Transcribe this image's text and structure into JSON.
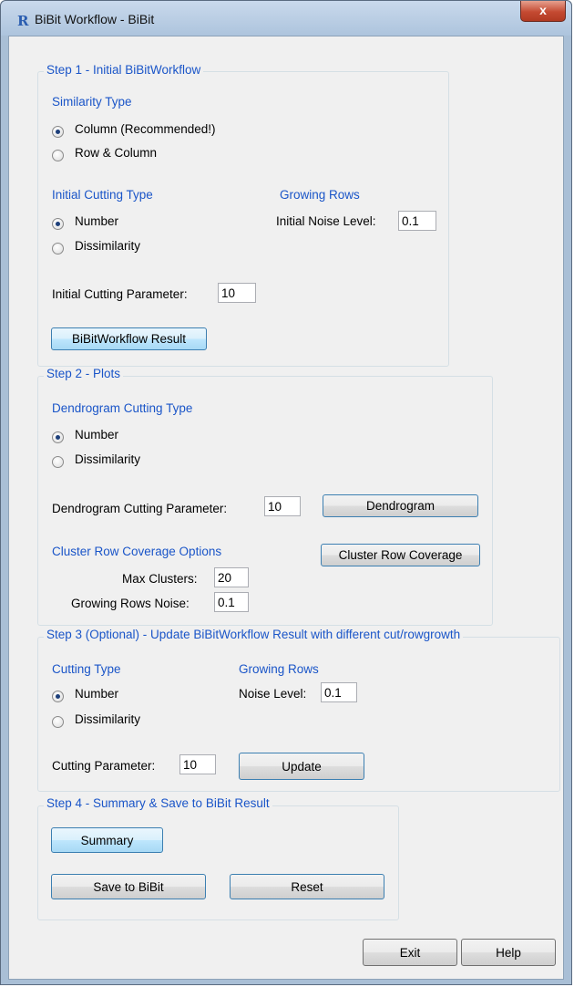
{
  "window": {
    "title": "BiBit Workflow - BiBit",
    "close_glyph": "x",
    "app_icon_glyph": "R"
  },
  "step1": {
    "legend": "Step 1 - Initial BiBitWorkflow",
    "similarity_heading": "Similarity Type",
    "similarity_options": [
      "Column (Recommended!)",
      "Row & Column"
    ],
    "similarity_selected": 0,
    "cutting_heading": "Initial Cutting Type",
    "cutting_options": [
      "Number",
      "Dissimilarity"
    ],
    "cutting_selected": 0,
    "growing_heading": "Growing Rows",
    "noise_label": "Initial Noise Level:",
    "noise_value": "0.1",
    "param_label": "Initial Cutting Parameter:",
    "param_value": "10",
    "result_button": "BiBitWorkflow Result"
  },
  "step2": {
    "legend": "Step 2 - Plots",
    "dendro_heading": "Dendrogram Cutting Type",
    "dendro_options": [
      "Number",
      "Dissimilarity"
    ],
    "dendro_selected": 0,
    "param_label": "Dendrogram Cutting Parameter:",
    "param_value": "10",
    "dendro_button": "Dendrogram",
    "coverage_heading": "Cluster Row Coverage Options",
    "max_clusters_label": "Max Clusters:",
    "max_clusters_value": "20",
    "noise_label": "Growing Rows Noise:",
    "noise_value": "0.1",
    "coverage_button": "Cluster Row Coverage"
  },
  "step3": {
    "legend": "Step 3 (Optional) - Update BiBitWorkflow Result with different cut/rowgrowth",
    "cutting_heading": "Cutting Type",
    "cutting_options": [
      "Number",
      "Dissimilarity"
    ],
    "cutting_selected": 0,
    "growing_heading": "Growing Rows",
    "noise_label": "Noise Level:",
    "noise_value": "0.1",
    "param_label": "Cutting Parameter:",
    "param_value": "10",
    "update_button": "Update"
  },
  "step4": {
    "legend": "Step 4 - Summary & Save to BiBit Result",
    "summary_button": "Summary",
    "save_button": "Save to BiBit",
    "reset_button": "Reset"
  },
  "footer": {
    "exit_button": "Exit",
    "help_button": "Help"
  },
  "colors": {
    "heading_blue": "#1a55c8",
    "window_frame": "#a9bfd6",
    "close_red": "#c44a32"
  }
}
